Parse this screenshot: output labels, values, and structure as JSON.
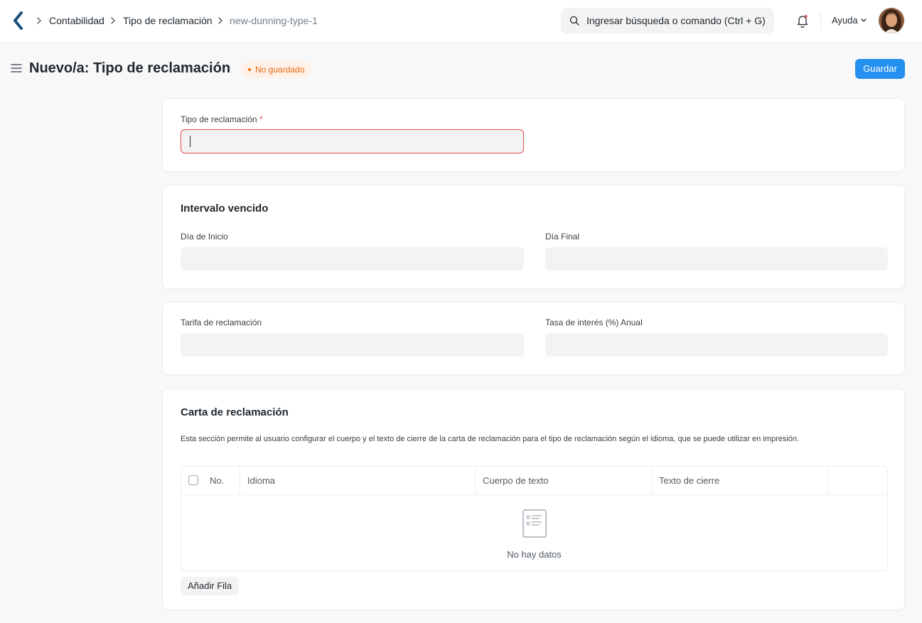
{
  "breadcrumbs": [
    "Contabilidad",
    "Tipo de reclamación",
    "new-dunning-type-1"
  ],
  "search": {
    "placeholder": "Ingresar búsqueda o comando (Ctrl + G)"
  },
  "navbar": {
    "help_label": "Ayuda"
  },
  "page": {
    "title": "Nuevo/a: Tipo de reclamación",
    "status": "No guardado",
    "save_label": "Guardar"
  },
  "form": {
    "dunning_type": {
      "label": "Tipo de reclamación",
      "required_mark": "*",
      "value": ""
    },
    "overdue_interval": {
      "title": "Intervalo vencido",
      "start_day_label": "Día de Inicio",
      "end_day_label": "Día Final"
    },
    "fees": {
      "dunning_fee_label": "Tarifa de reclamación",
      "interest_rate_label": "Tasa de interés (%) Anual"
    },
    "letter": {
      "title": "Carta de reclamación",
      "description": "Esta sección permite al usuario configurar el cuerpo y el texto de cierre de la carta de reclamación para el tipo de reclamación según el idioma, que se puede utilizar en impresión.",
      "columns": [
        "No.",
        "Idioma",
        "Cuerpo de texto",
        "Texto de cierre"
      ],
      "empty_text": "No hay datos",
      "add_row_label": "Añadir Fila"
    }
  },
  "colors": {
    "primary": "#2490ef",
    "warning": "#e86c13",
    "error": "#e24c4c"
  },
  "icons": [
    "back-logo-icon",
    "chevron-right-icon",
    "search-icon",
    "bell-icon",
    "chevron-down-icon",
    "hamburger-icon",
    "empty-list-icon"
  ]
}
